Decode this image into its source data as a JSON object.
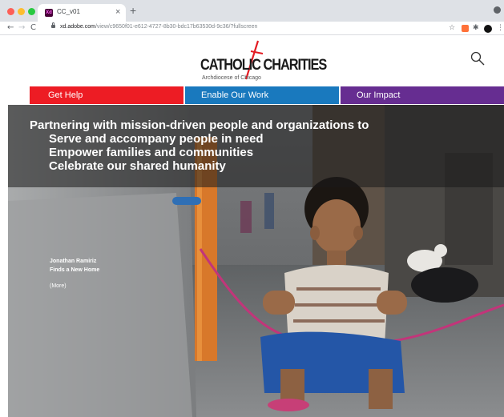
{
  "browser": {
    "tab_title": "CC_v01",
    "tab_favicon_text": "Xd",
    "tab_close": "×",
    "new_tab": "+",
    "url_host": "xd.adobe.com",
    "url_path": "/view/c9650f01-e612-4727-8b30-bdc17b63530d-9c36/?fullscreen",
    "icons": [
      "back-icon",
      "forward-icon",
      "reload-icon",
      "lock-icon",
      "star-icon",
      "extension-icon",
      "puzzle-icon",
      "profile-icon",
      "menu-icon"
    ],
    "colors": {
      "traffic_red": "#fd5f57",
      "traffic_yellow": "#fdbd2e",
      "traffic_green": "#28c940"
    }
  },
  "site": {
    "logo": {
      "name": "CATHOLIC CHARITIES",
      "subtitle": "Archdiocese of Chicago"
    },
    "nav": [
      {
        "label": "Get Help",
        "color": "#ed1c24"
      },
      {
        "label": "Enable Our Work",
        "color": "#1979be"
      },
      {
        "label": "Our Impact",
        "color": "#662d91"
      }
    ],
    "hero": {
      "headline": "Partnering with mission-driven people and organizations to",
      "bullets": [
        "Serve and accompany people in need",
        "Empower families and communities",
        "Celebrate our shared humanity"
      ],
      "story_line1": "Jonathan Ramiriz",
      "story_line2": "Finds a New Home",
      "more": "(More)"
    }
  }
}
